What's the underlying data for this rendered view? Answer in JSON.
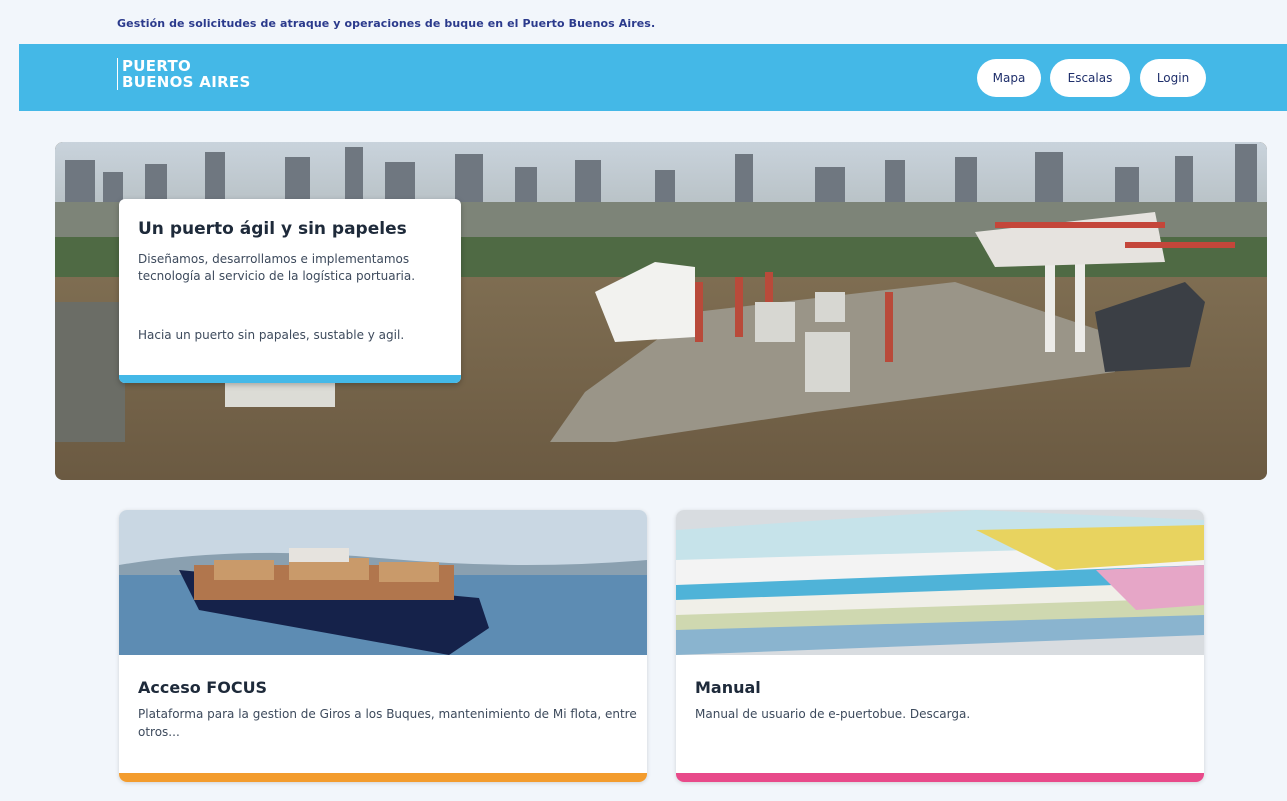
{
  "topbar": {
    "tagline": "Gestión de solicitudes de atraque y operaciones de buque en el Puerto Buenos Aires."
  },
  "header": {
    "logo_line1": "PUERTO",
    "logo_line2": "BUENOS AIRES",
    "nav": [
      {
        "label": "Mapa"
      },
      {
        "label": "Escalas"
      },
      {
        "label": "Login"
      }
    ]
  },
  "hero": {
    "title": "Un puerto ágil y sin papeles",
    "description": "Diseñamos, desarrollamos e implementamos tecnología al servicio de la logística portuaria.",
    "subtext": "Hacia un puerto sin papales, sustable y agil.",
    "accent_color": "#44b8e7"
  },
  "cards": [
    {
      "title": "Acceso FOCUS",
      "description": "Plataforma para la gestion de Giros a los Buques, mantenimiento de Mi flota, entre otros...",
      "accent_color": "#f39c2e"
    },
    {
      "title": "Manual",
      "description": "Manual de usuario de e-puertobue. Descarga.",
      "accent_color": "#e84a8a"
    }
  ],
  "colors": {
    "header_bg": "#44b8e7",
    "page_bg": "#f2f6fb",
    "nav_text": "#1f2f6b"
  }
}
